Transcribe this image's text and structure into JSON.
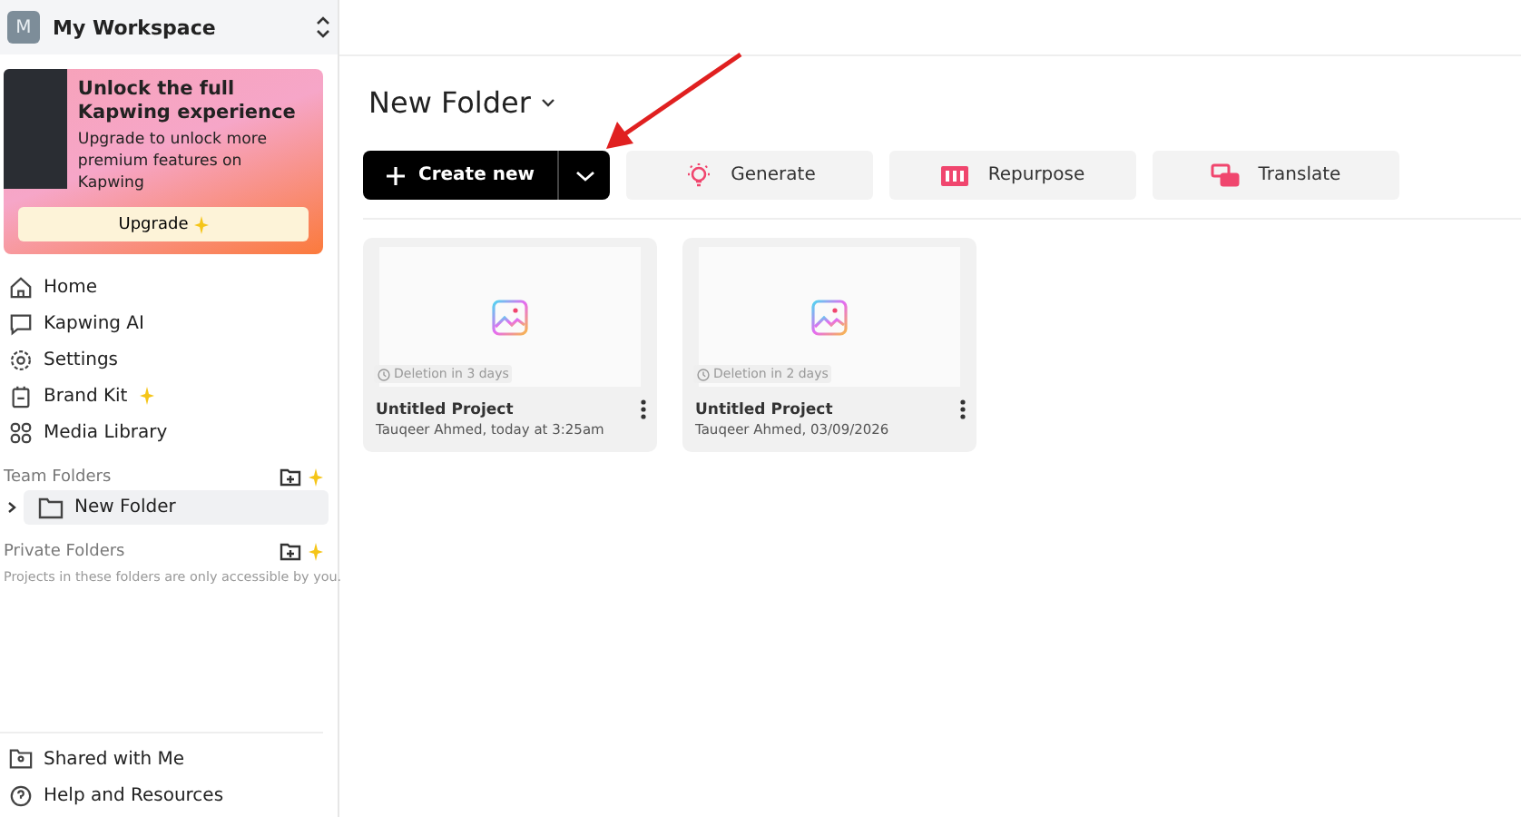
{
  "workspace": {
    "avatar": "M",
    "name": "My Workspace"
  },
  "promo": {
    "title": "Unlock the full Kapwing experience",
    "body": "Upgrade to unlock more premium features on Kapwing",
    "button": "Upgrade"
  },
  "nav": [
    {
      "label": "Home",
      "kind": "home",
      "sparkle": false
    },
    {
      "label": "Kapwing AI",
      "kind": "chat",
      "sparkle": false
    },
    {
      "label": "Settings",
      "kind": "settings",
      "sparkle": false
    },
    {
      "label": "Brand Kit",
      "kind": "brand",
      "sparkle": true
    },
    {
      "label": "Media Library",
      "kind": "media",
      "sparkle": false
    }
  ],
  "team_folders": {
    "heading": "Team Folders",
    "items": [
      {
        "label": "New Folder",
        "expanded": false,
        "selected": true
      }
    ]
  },
  "private_folders": {
    "heading": "Private Folders",
    "note": "Projects in these folders are only accessible by you."
  },
  "bottom_nav": [
    {
      "label": "Shared with Me",
      "kind": "shared"
    },
    {
      "label": "Help and Resources",
      "kind": "help"
    }
  ],
  "main": {
    "title": "New Folder",
    "create_button": "Create new",
    "actions": [
      {
        "label": "Generate",
        "kind": "generate"
      },
      {
        "label": "Repurpose",
        "kind": "repurpose"
      },
      {
        "label": "Translate",
        "kind": "translate"
      }
    ],
    "projects": [
      {
        "deletion": "Deletion in 3 days",
        "title": "Untitled Project",
        "meta": "Tauqeer Ahmed, today at 3:25am"
      },
      {
        "deletion": "Deletion in 2 days",
        "title": "Untitled Project",
        "meta": "Tauqeer Ahmed, 03/09/2026"
      }
    ]
  }
}
